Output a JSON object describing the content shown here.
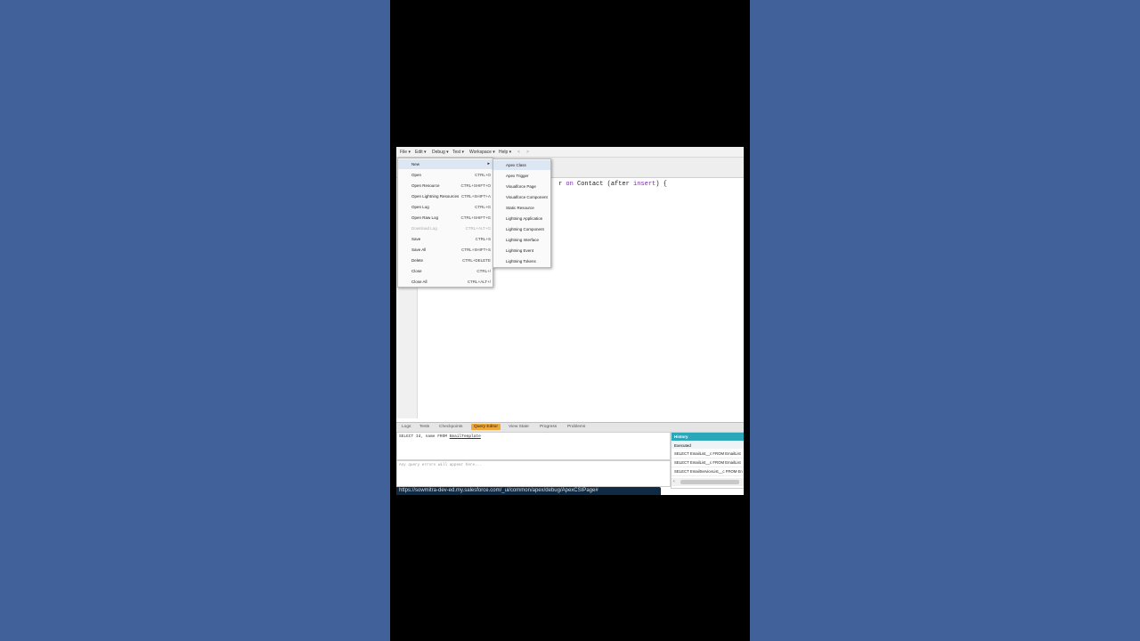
{
  "menubar": {
    "items": [
      "File ▾",
      "Edit ▾",
      "Debug ▾",
      "Test ▾",
      "Workspace ▾",
      "Help ▾",
      "<",
      ">"
    ]
  },
  "editor": {
    "code_kw_on": "on",
    "code_text": " Contact (after ",
    "code_kw_insert": "insert",
    "code_tail": ") {",
    "code_lead": "r "
  },
  "file_menu": {
    "items": [
      {
        "label": "New",
        "shortcut": ""
      },
      {
        "label": "Open",
        "shortcut": "CTRL+O"
      },
      {
        "label": "Open Resource",
        "shortcut": "CTRL+SHIFT+O"
      },
      {
        "label": "Open Lightning Resources",
        "shortcut": "CTRL+SHIFT+A"
      },
      {
        "label": "Open Log",
        "shortcut": "CTRL+G"
      },
      {
        "label": "Open Raw Log",
        "shortcut": "CTRL+SHIFT+G"
      },
      {
        "label": "Download Log",
        "shortcut": "CTRL+ALT+G"
      },
      {
        "label": "Save",
        "shortcut": "CTRL+S"
      },
      {
        "label": "Save All",
        "shortcut": "CTRL+SHIFT+S"
      },
      {
        "label": "Delete",
        "shortcut": "CTRL+DELETE"
      },
      {
        "label": "Close",
        "shortcut": "CTRL+/"
      },
      {
        "label": "Close All",
        "shortcut": "CTRL+ALT+/"
      }
    ]
  },
  "new_submenu": {
    "items": [
      "Apex Class",
      "Apex Trigger",
      "Visualforce Page",
      "Visualforce Component",
      "Static Resource",
      "Lightning Application",
      "Lightning Component",
      "Lightning Interface",
      "Lightning Event",
      "Lightning Tokens"
    ]
  },
  "bottom_tabs": [
    "Logs",
    "Tests",
    "Checkpoints",
    "Query Editor",
    "View State",
    "Progress",
    "Problems"
  ],
  "query": {
    "text_before": "SELECT Id, name FROM ",
    "text_object": "EmailTemplate",
    "errors_placeholder": "Any query errors will appear here..."
  },
  "history": {
    "title": "History",
    "subheader": "Executed",
    "rows": [
      "SELECT EmailList__c FROM EmailList",
      "SELECT EmailList__c FROM EmailList",
      "SELECT EmailServiceList__c FROM En"
    ],
    "scroll_left": "‹"
  },
  "status_url": "https://sowmitra-dev-ed.my.salesforce.com/_ui/common/apex/debug/ApexCSIPage#",
  "colors": {
    "page_bg": "#41619a",
    "accent_tab": "#f0a83a",
    "history_header": "#2aa7b8",
    "keyword": "#7a2aa8"
  }
}
